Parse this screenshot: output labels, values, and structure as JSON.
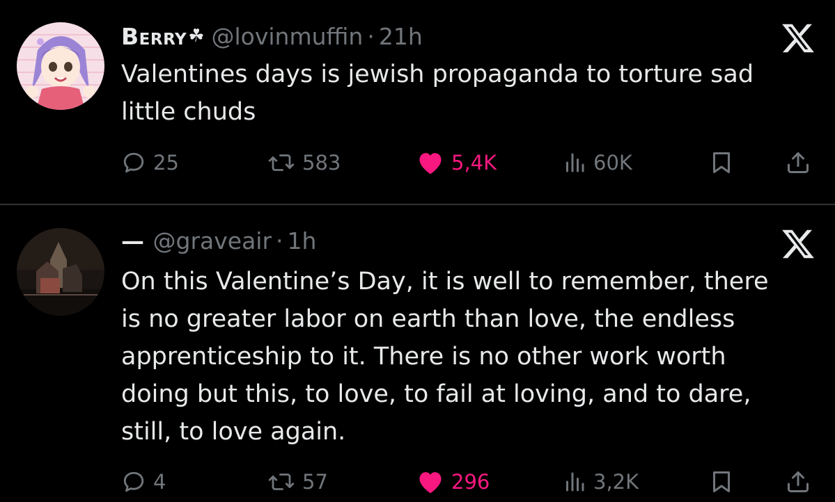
{
  "tweets": [
    {
      "display_name": "Berry",
      "display_suffix": "☘",
      "handle": "@lovinmuffin",
      "separator": "·",
      "time": "21h",
      "text": "Valentines days is jewish propaganda to torture sad\nlittle chuds",
      "replies": "25",
      "retweets": "583",
      "likes": "5,4K",
      "views": "60K",
      "liked": true
    },
    {
      "display_name": "—",
      "handle": "@graveair",
      "separator": "·",
      "time": "1h",
      "text": "On this Valentine’s Day, it is well to remember, there\nis no greater labor on earth than love, the endless\napprenticeship to it. There is no other work worth\ndoing but this, to love, to fail at loving, and to dare,\nstill, to love again.",
      "replies": "4",
      "retweets": "57",
      "likes": "296",
      "views": "3,2K",
      "liked": true
    }
  ],
  "colors": {
    "background": "#000000",
    "text_primary": "#e7e9ea",
    "text_secondary": "#71767b",
    "like_pink": "#f91880",
    "divider": "#2f3336"
  },
  "icons": [
    "x-logo-icon",
    "reply-icon",
    "retweet-icon",
    "heart-icon",
    "views-icon",
    "bookmark-icon",
    "share-icon"
  ]
}
